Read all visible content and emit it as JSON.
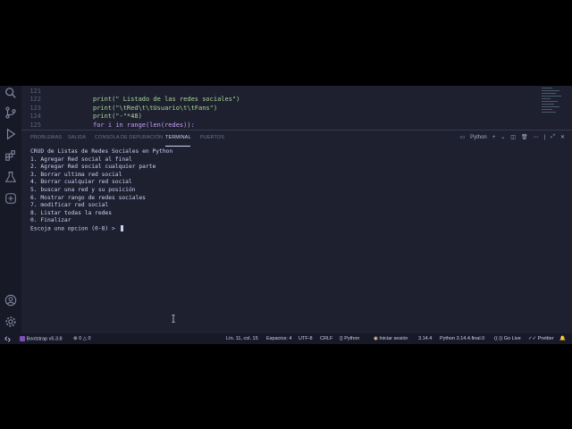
{
  "editor": {
    "lines": [
      {
        "num": "121",
        "code": ""
      },
      {
        "num": "122",
        "code": "print(\" Listado de las redes sociales\")"
      },
      {
        "num": "123",
        "code": "print(\"\\tRed\\t\\tUsuario\\t\\tFans\")"
      },
      {
        "num": "124",
        "code": "print(\"-\"*48)"
      },
      {
        "num": "125",
        "code": "for i in range(len(redes)):"
      }
    ]
  },
  "panel": {
    "tabs": [
      {
        "label": "PROBLEMAS"
      },
      {
        "label": "SALIDA"
      },
      {
        "label": "CONSOLA DE DEPURACIÓN"
      },
      {
        "label": "TERMINAL"
      },
      {
        "label": "PUERTOS"
      }
    ],
    "shell_label": "Python"
  },
  "terminal": {
    "lines": [
      "CRUD de Listas de Redes Sociales en Python",
      "1. Agregar Red social al final",
      "2. Agregar Red social cualquier parte",
      "3. Borrar ultima red social",
      "4. Borrar cualquier red social",
      "5. buscar una red y su posición",
      "6. Mostrar rango de redes sociales",
      "7. modificar red social",
      "8. Listar todas la redes",
      "0. Finalizar"
    ],
    "prompt": "Escoja una opcion (0-8) > "
  },
  "statusbar": {
    "bootstrap": "Bootstrap v5.3.8",
    "errors": "0",
    "warnings": "0",
    "position": "Lín. 11, col. 15",
    "spaces": "Espacios: 4",
    "encoding": "UTF-8",
    "eol": "CRLF",
    "language": "Python",
    "signin": "Iniciar sesión",
    "version": "3.14.4",
    "interpreter": "Python 3.14.4.final.0",
    "golive": "Go Live",
    "prettier": "Prettier"
  },
  "colors": {
    "accent": "#cad3f5",
    "background": "#1e2030",
    "string": "#a6da95",
    "function": "#eed49f"
  }
}
